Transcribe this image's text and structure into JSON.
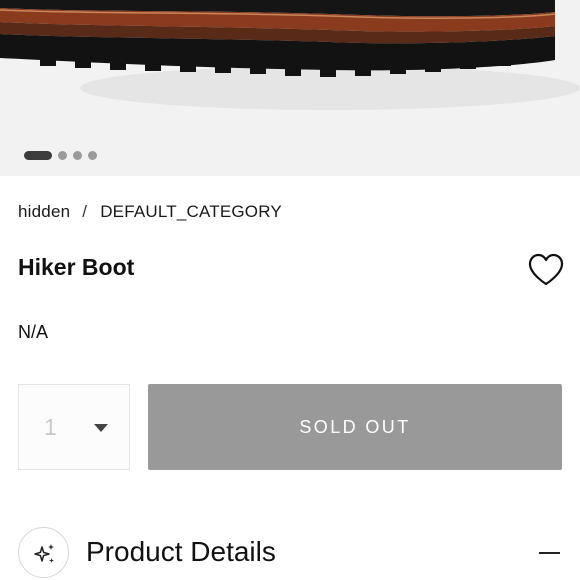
{
  "product_image": {
    "carousel_count": 4,
    "active_index": 0
  },
  "breadcrumb": {
    "items": [
      "hidden",
      "DEFAULT_CATEGORY"
    ],
    "separator": "/"
  },
  "product": {
    "title": "Hiker Boot",
    "price": "N/A"
  },
  "quantity": {
    "value": "1"
  },
  "actions": {
    "sold_out_label": "SOLD OUT"
  },
  "accordion": {
    "details_label": "Product Details"
  },
  "icons": {
    "wishlist": "heart-icon",
    "details": "sparkle-icon",
    "collapse": "minus-icon",
    "dropdown": "caret-down-icon"
  },
  "colors": {
    "sold_out_bg": "#999999",
    "hero_bg": "#f2f2f2",
    "active_dot": "#3c3c3c",
    "inactive_dot": "#9a9a9a"
  }
}
